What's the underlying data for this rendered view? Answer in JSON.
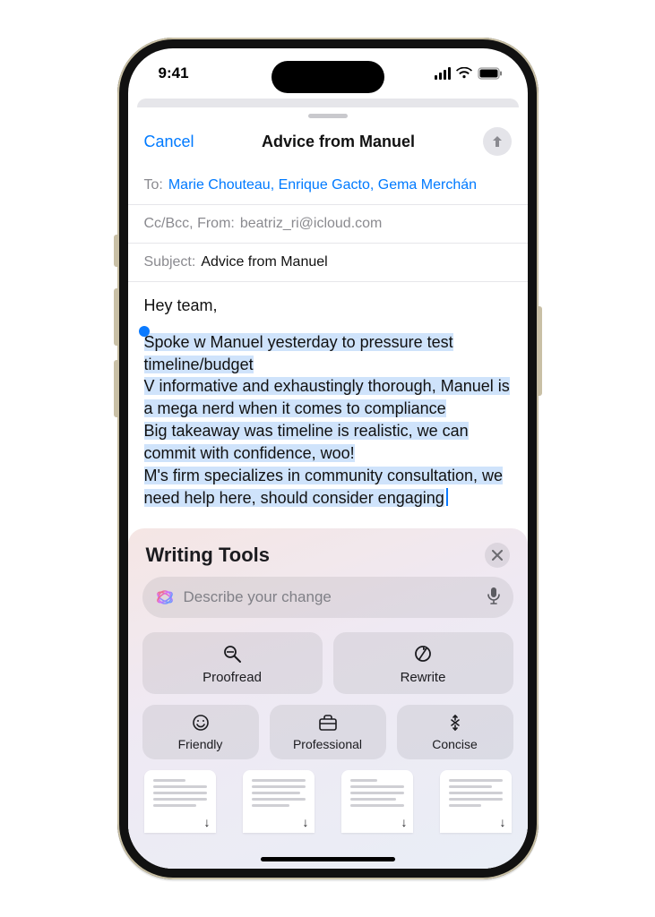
{
  "status": {
    "time": "9:41"
  },
  "nav": {
    "cancel": "Cancel",
    "title": "Advice from Manuel"
  },
  "compose": {
    "to_label": "To:",
    "recipients": "Marie Chouteau, Enrique Gacto, Gema Merchán",
    "ccbcc_label": "Cc/Bcc, From:",
    "from": "beatriz_ri@icloud.com",
    "subject_label": "Subject:",
    "subject": "Advice from Manuel",
    "greeting": "Hey team,",
    "selected_text": "Spoke w Manuel yesterday to pressure test timeline/budget\nV informative and exhaustingly thorough, Manuel is a mega nerd when it comes to compliance\nBig takeaway was timeline is realistic, we can commit with confidence, woo!\nM's firm specializes in community consultation, we need help here, should consider engaging"
  },
  "panel": {
    "title": "Writing Tools",
    "prompt_placeholder": "Describe your change",
    "buttons": {
      "proofread": "Proofread",
      "rewrite": "Rewrite",
      "friendly": "Friendly",
      "professional": "Professional",
      "concise": "Concise"
    }
  },
  "colors": {
    "accent": "#007aff",
    "selection": "#cfe3fb"
  }
}
